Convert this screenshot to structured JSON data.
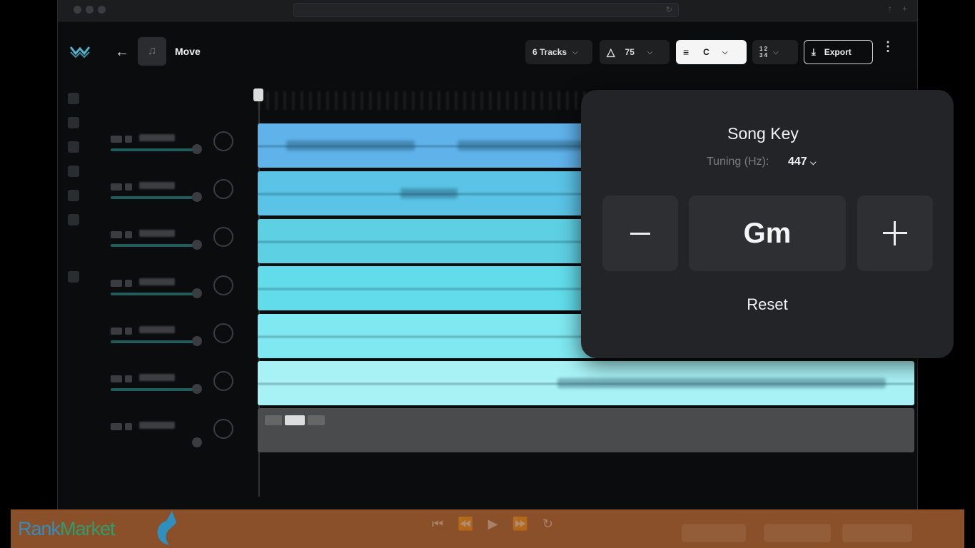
{
  "window": {
    "tab_icon": "reload-icon"
  },
  "header": {
    "song_title": "Move",
    "tracks_label": "6 Tracks",
    "tempo_value": "75",
    "key_value": "C",
    "time_sig_top": "1 2",
    "time_sig_bottom": "3 4",
    "export_label": "Export"
  },
  "tracks": [
    {
      "color": "#5fb2ea"
    },
    {
      "color": "#5ac3e6"
    },
    {
      "color": "#5ed0e3"
    },
    {
      "color": "#62dcea"
    },
    {
      "color": "#7fe8f0"
    },
    {
      "color": "#a8f2f5"
    }
  ],
  "popup": {
    "title": "Song Key",
    "tuning_label": "Tuning (Hz):",
    "tuning_value": "447",
    "key_value": "Gm",
    "reset_label": "Reset"
  },
  "banner": {
    "brand_part1": "Rank",
    "brand_part2": "Market",
    "bg_color": "#8a5029"
  }
}
